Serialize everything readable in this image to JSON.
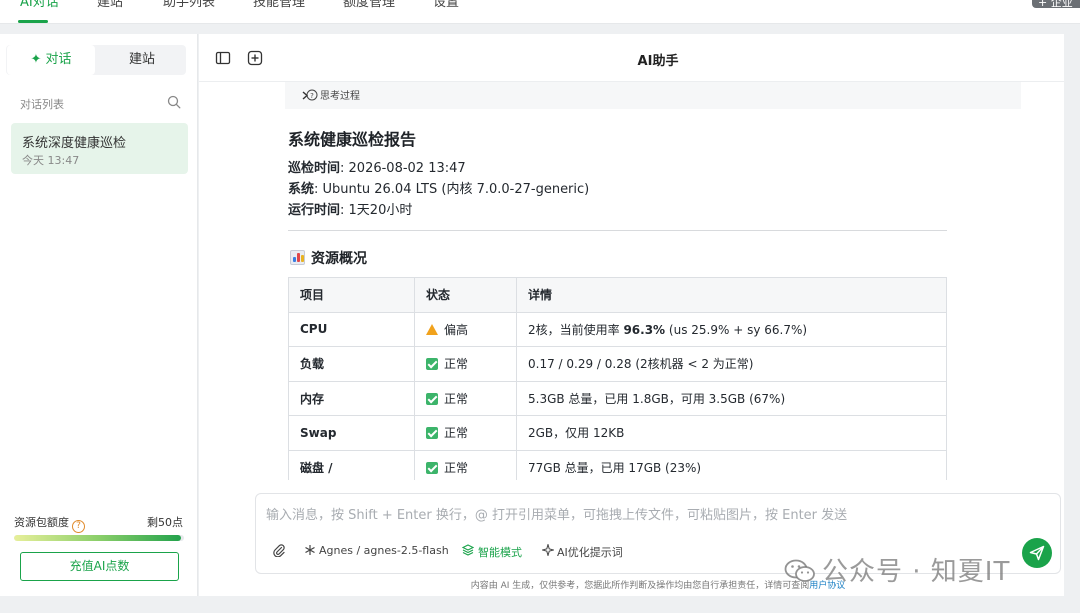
{
  "topnav": {
    "tabs": [
      "AI对话",
      "建站",
      "助手列表",
      "技能管理",
      "额度管理",
      "设置"
    ],
    "corner_button": "+ 企业"
  },
  "sidebar": {
    "segments": {
      "chat": "对话",
      "build": "建站"
    },
    "list_title": "对话列表",
    "conversations": [
      {
        "title": "系统深度健康巡检",
        "time": "今天 13:47"
      }
    ],
    "quota": {
      "label": "资源包额度",
      "remaining": "剩50点",
      "fill_fraction": 0.98
    },
    "recharge_label": "充值AI点数"
  },
  "header": {
    "title": "AI助手"
  },
  "think": {
    "label": "思考过程"
  },
  "report": {
    "title": "系统健康巡检报告",
    "meta": [
      {
        "key": "巡检时间",
        "value": ": 2026-08-02 13:47"
      },
      {
        "key": "系统",
        "value": ": Ubuntu 26.04 LTS (内核 7.0.0-27-generic)"
      },
      {
        "key": "运行时间",
        "value": ": 1天20小时"
      }
    ],
    "section_title": "资源概况",
    "columns": [
      "项目",
      "状态",
      "详情"
    ],
    "rows": [
      {
        "item": "CPU",
        "status": "偏高",
        "status_type": "warn",
        "detail_pre": "2核，当前使用率 ",
        "detail_bold": "96.3%",
        "detail_post": " (us 25.9% + sy 66.7%)"
      },
      {
        "item": "负载",
        "status": "正常",
        "status_type": "ok",
        "detail_pre": "0.17 / 0.29 / 0.28 (2核机器 < 2 为正常)",
        "detail_bold": "",
        "detail_post": ""
      },
      {
        "item": "内存",
        "status": "正常",
        "status_type": "ok",
        "detail_pre": "5.3GB 总量，已用 1.8GB，可用 3.5GB (67%)",
        "detail_bold": "",
        "detail_post": ""
      },
      {
        "item": "Swap",
        "status": "正常",
        "status_type": "ok",
        "detail_pre": "2GB，仅用 12KB",
        "detail_bold": "",
        "detail_post": ""
      },
      {
        "item": "磁盘 /",
        "status": "正常",
        "status_type": "ok",
        "detail_pre": "77GB 总量，已用 17GB (23%)",
        "detail_bold": "",
        "detail_post": ""
      }
    ]
  },
  "composer": {
    "placeholder": "输入消息，按 Shift + Enter 换行，@ 打开引用菜单，可拖拽上传文件，可粘贴图片，按 Enter 发送",
    "model": "Agnes / agnes-2.5-flash",
    "smart_mode": "智能模式",
    "optimize": "AI优化提示词"
  },
  "footer_note": {
    "text": "内容由 AI 生成，仅供参考，您据此所作判断及操作均由您自行承担责任，详情可查阅",
    "link": "用户协议"
  },
  "watermark": "公众号 · 知夏IT",
  "colors": {
    "accent": "#1aa34a",
    "warning": "#f1a21c",
    "ok": "#3cb46a"
  }
}
